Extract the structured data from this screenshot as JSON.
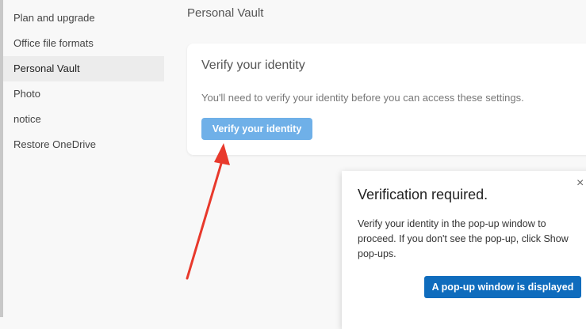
{
  "sidebar": {
    "items": [
      {
        "label": "Plan and upgrade"
      },
      {
        "label": "Office file formats"
      },
      {
        "label": "Personal Vault"
      },
      {
        "label": "Photo"
      },
      {
        "label": "notice"
      },
      {
        "label": "Restore OneDrive"
      }
    ],
    "active": "Personal Vault"
  },
  "page": {
    "title": "Personal Vault"
  },
  "card": {
    "title": "Verify your identity",
    "description": "You'll need to verify your identity before you can access these settings.",
    "button_label": "Verify your identity"
  },
  "popup": {
    "title": "Verification required.",
    "close_glyph": "×",
    "body": "Verify your identity in the pop-up window to proceed. If you don't see the pop-up, click Show pop-ups.",
    "button_label": "A pop-up window is displayed"
  },
  "colors": {
    "verify_button": "#6fb0e8",
    "popup_button": "#0f6cbd",
    "annotation_arrow": "#e8392c"
  }
}
